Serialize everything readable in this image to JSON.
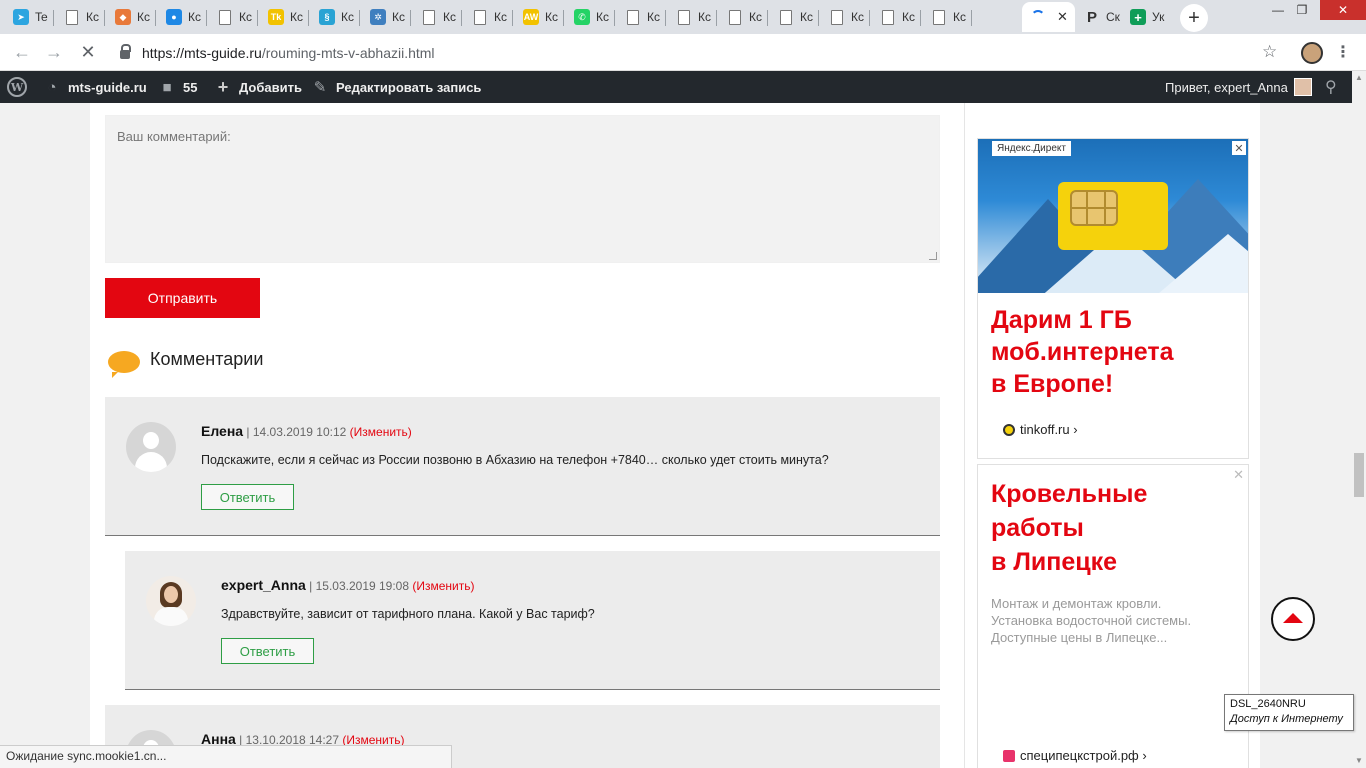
{
  "browser": {
    "tabs": [
      {
        "title": "Te",
        "icon": "telegram-icon",
        "color": "#2ca5e0"
      },
      {
        "title": "Кс",
        "icon": "document-icon"
      },
      {
        "title": "Кс",
        "icon": "fox-icon",
        "color": "#e8793a"
      },
      {
        "title": "Кс",
        "icon": "drop-icon",
        "color": "#1e88e5"
      },
      {
        "title": "Кс",
        "icon": "document-icon"
      },
      {
        "title": "Кс",
        "icon": "tk-icon",
        "color": "#f2c200"
      },
      {
        "title": "Кс",
        "icon": "dna-icon",
        "color": "#29a3d4"
      },
      {
        "title": "Кс",
        "icon": "settings-icon",
        "color": "#3f7fbf"
      },
      {
        "title": "Кс",
        "icon": "document-icon"
      },
      {
        "title": "Кс",
        "icon": "document-icon"
      },
      {
        "title": "Кс",
        "icon": "aw-icon",
        "color": "#f2c200"
      },
      {
        "title": "Кс",
        "icon": "whatsapp-icon",
        "color": "#25d366"
      },
      {
        "title": "Кс",
        "icon": "document-icon"
      },
      {
        "title": "Кс",
        "icon": "document-icon"
      },
      {
        "title": "Кс",
        "icon": "document-icon"
      },
      {
        "title": "Кс",
        "icon": "document-icon"
      },
      {
        "title": "Кс",
        "icon": "document-icon"
      },
      {
        "title": "Кс",
        "icon": "document-icon"
      },
      {
        "title": "Кс",
        "icon": "document-icon"
      }
    ],
    "active_tab_close": "✕",
    "extra_tabs": [
      {
        "title": "Ск",
        "icon": "p-icon",
        "color": "#333333"
      },
      {
        "title": "Ук",
        "icon": "plus-sheet-icon",
        "color": "#0f9d58"
      }
    ],
    "new_tab": "+",
    "url_host": "https://mts-guide.ru",
    "url_path": "/rouming-mts-v-abhazii.html"
  },
  "adminbar": {
    "site": "mts-guide.ru",
    "comments_count": "55",
    "add": "Добавить",
    "edit": "Редактировать запись",
    "greeting": "Привет, expert_Anna"
  },
  "form": {
    "comment_placeholder": "Ваш комментарий:",
    "submit": "Отправить"
  },
  "comments": {
    "title": "Комментарии",
    "items": [
      {
        "author": "Елена",
        "date": "14.03.2019 10:12",
        "edit": "(Изменить)",
        "text": "Подскажите, если я сейчас из России позвоню в Абхазию на телефон +7840… сколько удет стоить минута?",
        "reply": "Ответить"
      },
      {
        "author": "expert_Anna",
        "date": "15.03.2019 19:08",
        "edit": "(Изменить)",
        "text": "Здравствуйте, зависит от тарифного плана. Какой у Вас тариф?",
        "reply": "Ответить"
      },
      {
        "author": "Анна",
        "date": "13.10.2018 14:27",
        "edit": "(Изменить)"
      }
    ]
  },
  "ads": {
    "ad1": {
      "label": "Яндекс.Директ",
      "headline": [
        "Дарим 1 ГБ",
        "моб.интернета",
        "в Европе!"
      ],
      "domain": "tinkoff.ru ›"
    },
    "ad2": {
      "headline": [
        "Кровельные",
        "работы",
        "в Липецке"
      ],
      "description": [
        "Монтаж и демонтаж кровли.",
        "Установка водосточной системы.",
        "Доступные цены в Липецке..."
      ],
      "domain": "специпецкстрой.рф ›"
    }
  },
  "tooltip": {
    "title": "DSL_2640NRU",
    "subtitle": "Доступ к Интернету"
  },
  "status": "Ожидание sync.mookie1.cn...",
  "colors": {
    "brand_red": "#e30611",
    "reply_green": "#2e9e45",
    "adminbar_bg": "#23282d"
  }
}
